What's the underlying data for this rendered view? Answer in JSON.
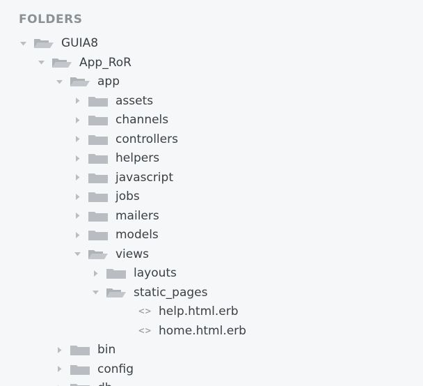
{
  "sidebar": {
    "header": "FOLDERS",
    "items": [
      {
        "label": "GUIA8",
        "kind": "folder",
        "expanded": true,
        "depth": 0
      },
      {
        "label": "App_RoR",
        "kind": "folder",
        "expanded": true,
        "depth": 1
      },
      {
        "label": "app",
        "kind": "folder",
        "expanded": true,
        "depth": 2
      },
      {
        "label": "assets",
        "kind": "folder",
        "expanded": false,
        "depth": 3
      },
      {
        "label": "channels",
        "kind": "folder",
        "expanded": false,
        "depth": 3
      },
      {
        "label": "controllers",
        "kind": "folder",
        "expanded": false,
        "depth": 3
      },
      {
        "label": "helpers",
        "kind": "folder",
        "expanded": false,
        "depth": 3
      },
      {
        "label": "javascript",
        "kind": "folder",
        "expanded": false,
        "depth": 3
      },
      {
        "label": "jobs",
        "kind": "folder",
        "expanded": false,
        "depth": 3
      },
      {
        "label": "mailers",
        "kind": "folder",
        "expanded": false,
        "depth": 3
      },
      {
        "label": "models",
        "kind": "folder",
        "expanded": false,
        "depth": 3
      },
      {
        "label": "views",
        "kind": "folder",
        "expanded": true,
        "depth": 3
      },
      {
        "label": "layouts",
        "kind": "folder",
        "expanded": false,
        "depth": 4
      },
      {
        "label": "static_pages",
        "kind": "folder",
        "expanded": true,
        "depth": 4
      },
      {
        "label": "help.html.erb",
        "kind": "file",
        "icon": "<>",
        "depth": 5
      },
      {
        "label": "home.html.erb",
        "kind": "file",
        "icon": "<>",
        "depth": 5
      },
      {
        "label": "bin",
        "kind": "folder",
        "expanded": false,
        "depth": 2
      },
      {
        "label": "config",
        "kind": "folder",
        "expanded": false,
        "depth": 2
      },
      {
        "label": "db",
        "kind": "folder",
        "expanded": false,
        "depth": 2
      }
    ]
  }
}
